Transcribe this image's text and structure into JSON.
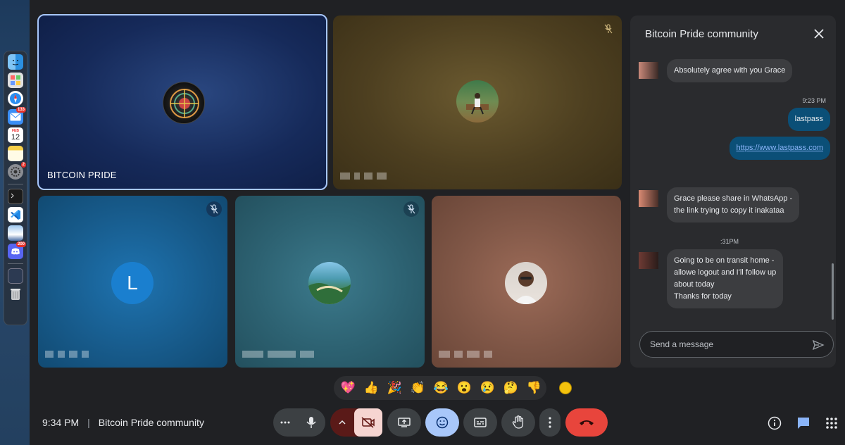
{
  "colors": {
    "end_call": "#e8453c",
    "active_ctrl": "#8ab4f8",
    "camera_off": "#f6d5d1",
    "outgoing_bubble": "#0b4f77",
    "link": "#8ab4f8"
  },
  "dock": {
    "icons": [
      "finder-icon",
      "launchpad-icon",
      "safari-icon",
      "mail-icon",
      "calendar-icon",
      "notes-icon",
      "system-settings-icon",
      "terminal-icon",
      "vscode-icon",
      "preview-icon",
      "discord-icon",
      "window-icon",
      "trash-icon"
    ],
    "mail_badge": "133",
    "calendar_month": "FEB",
    "calendar_day": "12",
    "settings_badge": "2",
    "discord_badge": "200"
  },
  "tiles": {
    "main": {
      "name": "BITCOIN PRIDE"
    },
    "letter_avatar": "L"
  },
  "chat": {
    "title": "Bitcoin Pride community",
    "messages": [
      {
        "direction": "in",
        "text": "Absolutely agree with you Grace"
      },
      {
        "direction": "out",
        "time": "9:23 PM",
        "text": "lastpass"
      },
      {
        "direction": "out",
        "text": "https://www.lastpass.com"
      },
      {
        "direction": "in",
        "text_lines": [
          "Grace please share in WhatsApp -",
          "the link trying to copy it inakataa"
        ]
      },
      {
        "direction": "in",
        "time": ":31PM",
        "text_lines": [
          "Going to be on transit home -",
          "allowe logout and I'll follow up",
          "about today",
          "Thanks for today"
        ]
      }
    ],
    "input_placeholder": "Send a message"
  },
  "reactions": [
    "💖",
    "👍",
    "🎉",
    "👏",
    "😂",
    "😮",
    "😢",
    "🤔",
    "👎"
  ],
  "footer": {
    "time": "9:34 PM",
    "separator": "|",
    "meeting_name": "Bitcoin Pride community"
  }
}
